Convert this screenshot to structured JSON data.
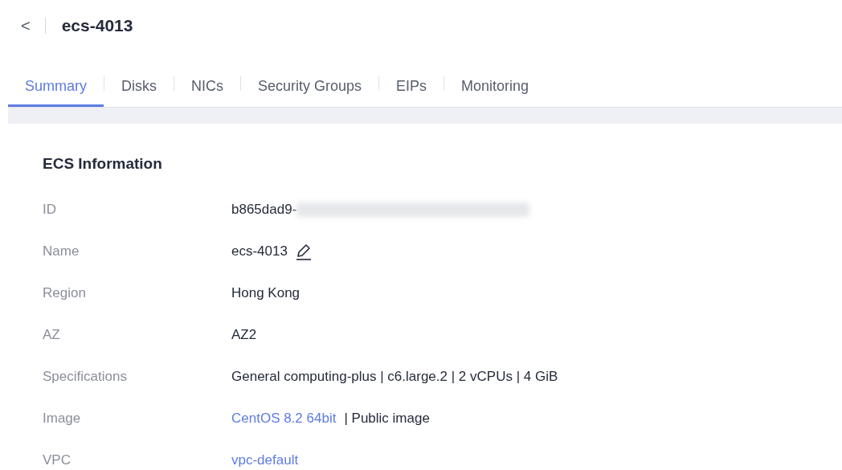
{
  "header": {
    "back": "<",
    "title": "ecs-4013"
  },
  "tabs": [
    {
      "label": "Summary",
      "selected": true
    },
    {
      "label": "Disks",
      "selected": false
    },
    {
      "label": "NICs",
      "selected": false
    },
    {
      "label": "Security Groups",
      "selected": false
    },
    {
      "label": "EIPs",
      "selected": false
    },
    {
      "label": "Monitoring",
      "selected": false
    }
  ],
  "section": {
    "title": "ECS Information",
    "rows": [
      {
        "label": "ID",
        "kind": "redacted",
        "value": "b865dad9-"
      },
      {
        "label": "Name",
        "kind": "editable",
        "value": "ecs-4013"
      },
      {
        "label": "Region",
        "kind": "text",
        "value": "Hong Kong"
      },
      {
        "label": "AZ",
        "kind": "text",
        "value": "AZ2"
      },
      {
        "label": "Specifications",
        "kind": "text",
        "value": "General computing-plus | c6.large.2 | 2 vCPUs | 4 GiB"
      },
      {
        "label": "Image",
        "kind": "link_text",
        "link": "CentOS 8.2 64bit",
        "value": "| Public image"
      },
      {
        "label": "VPC",
        "kind": "link",
        "link": "vpc-default"
      }
    ]
  }
}
